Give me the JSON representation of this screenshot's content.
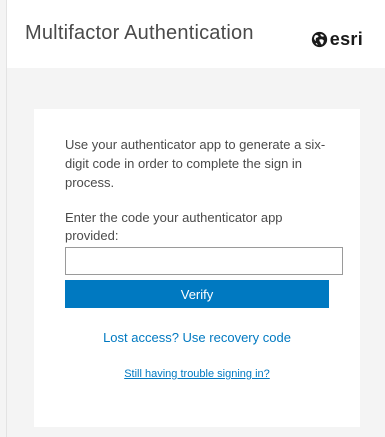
{
  "header": {
    "title": "Multifactor Authentication",
    "brand_icon": "globe-icon",
    "brand_text": "esri"
  },
  "card": {
    "intro": "Use your authenticator app to generate a six-digit code in order to complete the sign in process.",
    "code_label": "Enter the code your authenticator app provided:",
    "code_value": "",
    "verify_label": "Verify",
    "recovery_link": "Lost access? Use recovery code",
    "trouble_link": "Still having trouble signing in?"
  },
  "colors": {
    "accent": "#0079c1",
    "background": "#f4f4f4",
    "text": "#4a4a4a"
  }
}
